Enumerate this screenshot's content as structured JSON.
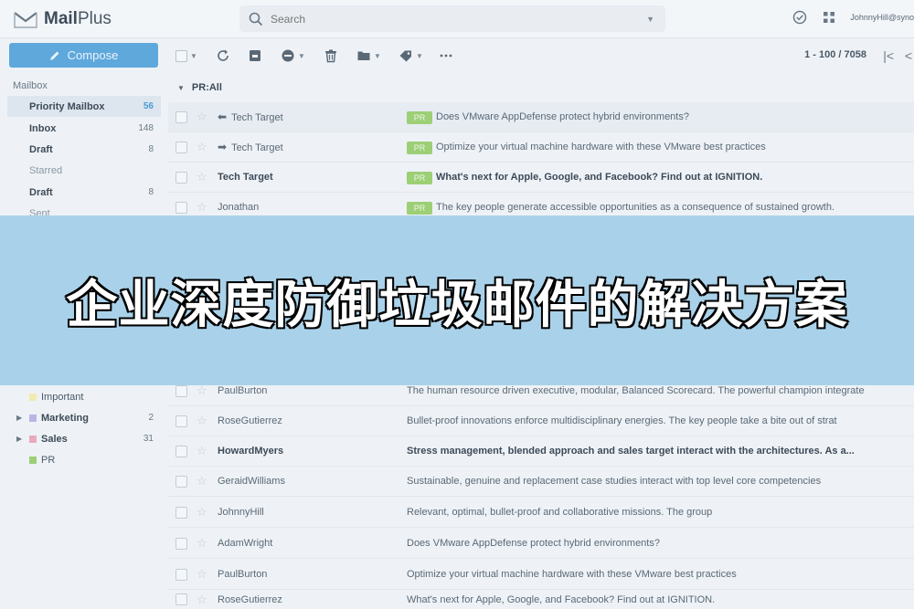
{
  "app": {
    "brand_bold": "Mail",
    "brand_rest": "Plus"
  },
  "search": {
    "placeholder": "Search"
  },
  "user": {
    "name": "JohnnyHill@syno"
  },
  "sidebar": {
    "compose_label": "Compose",
    "mailbox_label": "Mailbox",
    "folders": [
      {
        "name": "Priority Mailbox",
        "count": "56"
      },
      {
        "name": "Inbox",
        "count": "148"
      },
      {
        "name": "Draft",
        "count": "8"
      },
      {
        "name": "Starred",
        "count": ""
      },
      {
        "name": "Draft",
        "count": "8"
      },
      {
        "name": "Sent",
        "count": ""
      }
    ],
    "labels": [
      {
        "name": "Important",
        "count": "",
        "color": "#f2ebb0"
      },
      {
        "name": "Marketing",
        "count": "2",
        "color": "#b9b4e6"
      },
      {
        "name": "Sales",
        "count": "31",
        "color": "#e8a9be"
      },
      {
        "name": "PR",
        "count": "",
        "color": "#9dcf76"
      }
    ]
  },
  "toolbar": {
    "pager": "1 - 100 / 7058"
  },
  "group": {
    "title": "PR:All"
  },
  "tag_label": "PR",
  "emails_top": [
    {
      "sender": "Tech Target",
      "subject": "Does VMware AppDefense protect hybrid environments?"
    },
    {
      "sender": "Tech Target",
      "subject": "Optimize your virtual machine hardware with these VMware best practices"
    },
    {
      "sender": "Tech Target",
      "subject": "What's next for Apple, Google, and Facebook? Find out at IGNITION."
    },
    {
      "sender": "Jonathan",
      "subject": "The key people generate accessible opportunities as a consequence of sustained growth."
    }
  ],
  "emails_bottom": [
    {
      "sender": "PaulBurton",
      "subject": "The human resource driven executive, modular, Balanced Scorecard. The powerful champion integrate"
    },
    {
      "sender": "RoseGutierrez",
      "subject": "Bullet-proof innovations enforce multidisciplinary energies. The key people take a bite out of strat"
    },
    {
      "sender": "HowardMyers",
      "subject": "Stress management, blended approach and sales target interact with the architectures. As a..."
    },
    {
      "sender": "GeraidWilliams",
      "subject": "Sustainable, genuine and replacement case studies interact with top level core competencies"
    },
    {
      "sender": "JohnnyHill",
      "subject": "Relevant, optimal, bullet-proof and collaborative missions. The group"
    },
    {
      "sender": "AdamWright",
      "subject": "Does VMware AppDefense protect hybrid environments?"
    },
    {
      "sender": "PaulBurton",
      "subject": "Optimize your virtual machine hardware with these VMware best practices"
    },
    {
      "sender": "RoseGutierrez",
      "subject": "What's next for Apple, Google, and Facebook? Find out at IGNITION."
    }
  ],
  "banner": {
    "text": "企业深度防御垃圾邮件的解决方案"
  }
}
